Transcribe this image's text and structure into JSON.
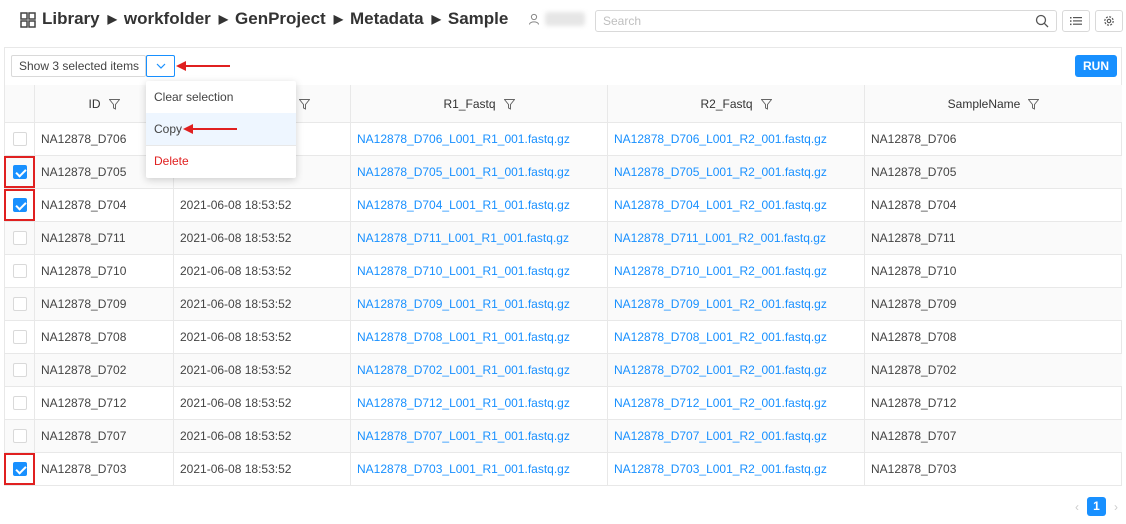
{
  "breadcrumb": [
    "Library",
    "workfolder",
    "GenProject",
    "Metadata",
    "Sample"
  ],
  "search": {
    "placeholder": "Search"
  },
  "toolbar": {
    "selection_label": "Show 3 selected items",
    "run_label": "RUN"
  },
  "menu": {
    "clear": "Clear selection",
    "copy": "Copy",
    "delete": "Delete"
  },
  "table": {
    "headers": [
      "ID",
      "",
      "R1_Fastq",
      "R2_Fastq",
      "SampleName"
    ],
    "rows": [
      {
        "checked": false,
        "id": "NA12878_D706",
        "date": "",
        "r1": "NA12878_D706_L001_R1_001.fastq.gz",
        "r2": "NA12878_D706_L001_R2_001.fastq.gz",
        "name": "NA12878_D706"
      },
      {
        "checked": true,
        "id": "NA12878_D705",
        "date": "",
        "r1": "NA12878_D705_L001_R1_001.fastq.gz",
        "r2": "NA12878_D705_L001_R2_001.fastq.gz",
        "name": "NA12878_D705"
      },
      {
        "checked": true,
        "id": "NA12878_D704",
        "date": "2021-06-08 18:53:52",
        "r1": "NA12878_D704_L001_R1_001.fastq.gz",
        "r2": "NA12878_D704_L001_R2_001.fastq.gz",
        "name": "NA12878_D704"
      },
      {
        "checked": false,
        "id": "NA12878_D711",
        "date": "2021-06-08 18:53:52",
        "r1": "NA12878_D711_L001_R1_001.fastq.gz",
        "r2": "NA12878_D711_L001_R2_001.fastq.gz",
        "name": "NA12878_D711"
      },
      {
        "checked": false,
        "id": "NA12878_D710",
        "date": "2021-06-08 18:53:52",
        "r1": "NA12878_D710_L001_R1_001.fastq.gz",
        "r2": "NA12878_D710_L001_R2_001.fastq.gz",
        "name": "NA12878_D710"
      },
      {
        "checked": false,
        "id": "NA12878_D709",
        "date": "2021-06-08 18:53:52",
        "r1": "NA12878_D709_L001_R1_001.fastq.gz",
        "r2": "NA12878_D709_L001_R2_001.fastq.gz",
        "name": "NA12878_D709"
      },
      {
        "checked": false,
        "id": "NA12878_D708",
        "date": "2021-06-08 18:53:52",
        "r1": "NA12878_D708_L001_R1_001.fastq.gz",
        "r2": "NA12878_D708_L001_R2_001.fastq.gz",
        "name": "NA12878_D708"
      },
      {
        "checked": false,
        "id": "NA12878_D702",
        "date": "2021-06-08 18:53:52",
        "r1": "NA12878_D702_L001_R1_001.fastq.gz",
        "r2": "NA12878_D702_L001_R2_001.fastq.gz",
        "name": "NA12878_D702"
      },
      {
        "checked": false,
        "id": "NA12878_D712",
        "date": "2021-06-08 18:53:52",
        "r1": "NA12878_D712_L001_R1_001.fastq.gz",
        "r2": "NA12878_D712_L001_R2_001.fastq.gz",
        "name": "NA12878_D712"
      },
      {
        "checked": false,
        "id": "NA12878_D707",
        "date": "2021-06-08 18:53:52",
        "r1": "NA12878_D707_L001_R1_001.fastq.gz",
        "r2": "NA12878_D707_L001_R2_001.fastq.gz",
        "name": "NA12878_D707"
      },
      {
        "checked": true,
        "id": "NA12878_D703",
        "date": "2021-06-08 18:53:52",
        "r1": "NA12878_D703_L001_R1_001.fastq.gz",
        "r2": "NA12878_D703_L001_R2_001.fastq.gz",
        "name": "NA12878_D703"
      }
    ]
  },
  "pagination": {
    "current": "1"
  },
  "colors": {
    "accent": "#1890ff",
    "annotation": "#e02020"
  },
  "icons": [
    "library-grid-icon",
    "user-icon",
    "search-icon",
    "list-icon",
    "settings-icon",
    "chevron-down-icon",
    "filter-icon",
    "chevron-left-icon",
    "chevron-right-icon"
  ]
}
